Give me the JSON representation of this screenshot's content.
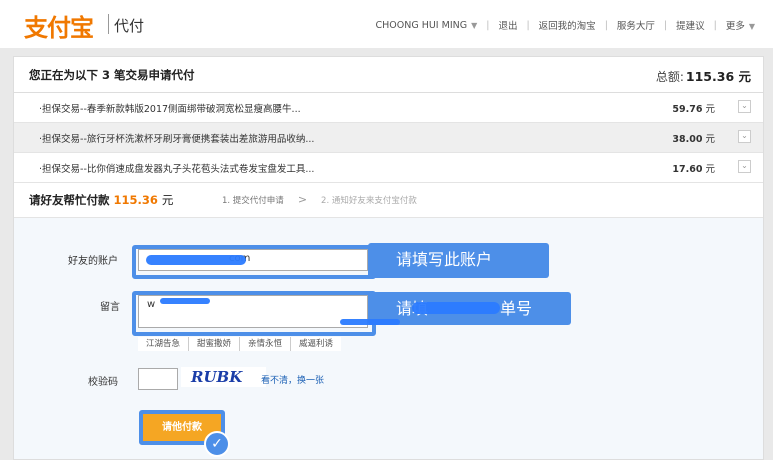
{
  "header": {
    "logo": "支付宝",
    "logo_sub": "代付",
    "nav": {
      "user": "CHOONG HUI MING",
      "logout": "退出",
      "back_taobao": "返回我的淘宝",
      "service": "服务大厅",
      "suggest": "提建议",
      "more": "更多"
    }
  },
  "summary": {
    "title": "您正在为以下 3 笔交易申请代付",
    "total_label": "总额:",
    "total_value": "115.36 元"
  },
  "orders": [
    {
      "title": "·担保交易--春季新款韩版2017侧面绑带破洞宽松显瘦高腰牛...",
      "amount": "59.76",
      "unit": "元"
    },
    {
      "title": "·担保交易--旅行牙杯洗漱杯牙刷牙膏便携套装出差旅游用品收纳...",
      "amount": "38.00",
      "unit": "元"
    },
    {
      "title": "·担保交易--比你俏速成盘发器丸子头花苞头法式卷发宝盘发工具...",
      "amount": "17.60",
      "unit": "元"
    }
  ],
  "ask": {
    "label": "请好友帮忙付款",
    "amount": "115.36",
    "unit": "元",
    "step1": "1. 提交代付申请",
    "step2": "2. 通知好友来支付宝付款"
  },
  "form": {
    "friend_label": "好友的账户",
    "friend_value": "com",
    "friend_tip": "请填写此账户",
    "message_label": "留言",
    "message_value": "w",
    "message_tip": "请填",
    "message_tip_tail": "单号",
    "tags": [
      "江湖告急",
      "甜蜜撒娇",
      "亲情永恒",
      "威逼利诱"
    ],
    "captcha_label": "校验码",
    "captcha_text": "RUBK",
    "captcha_refresh": "看不清，换一张",
    "pay_button": "请他付款"
  },
  "colors": {
    "accent": "#4d8fe8",
    "brand": "#f07800",
    "button": "#f5a623"
  }
}
